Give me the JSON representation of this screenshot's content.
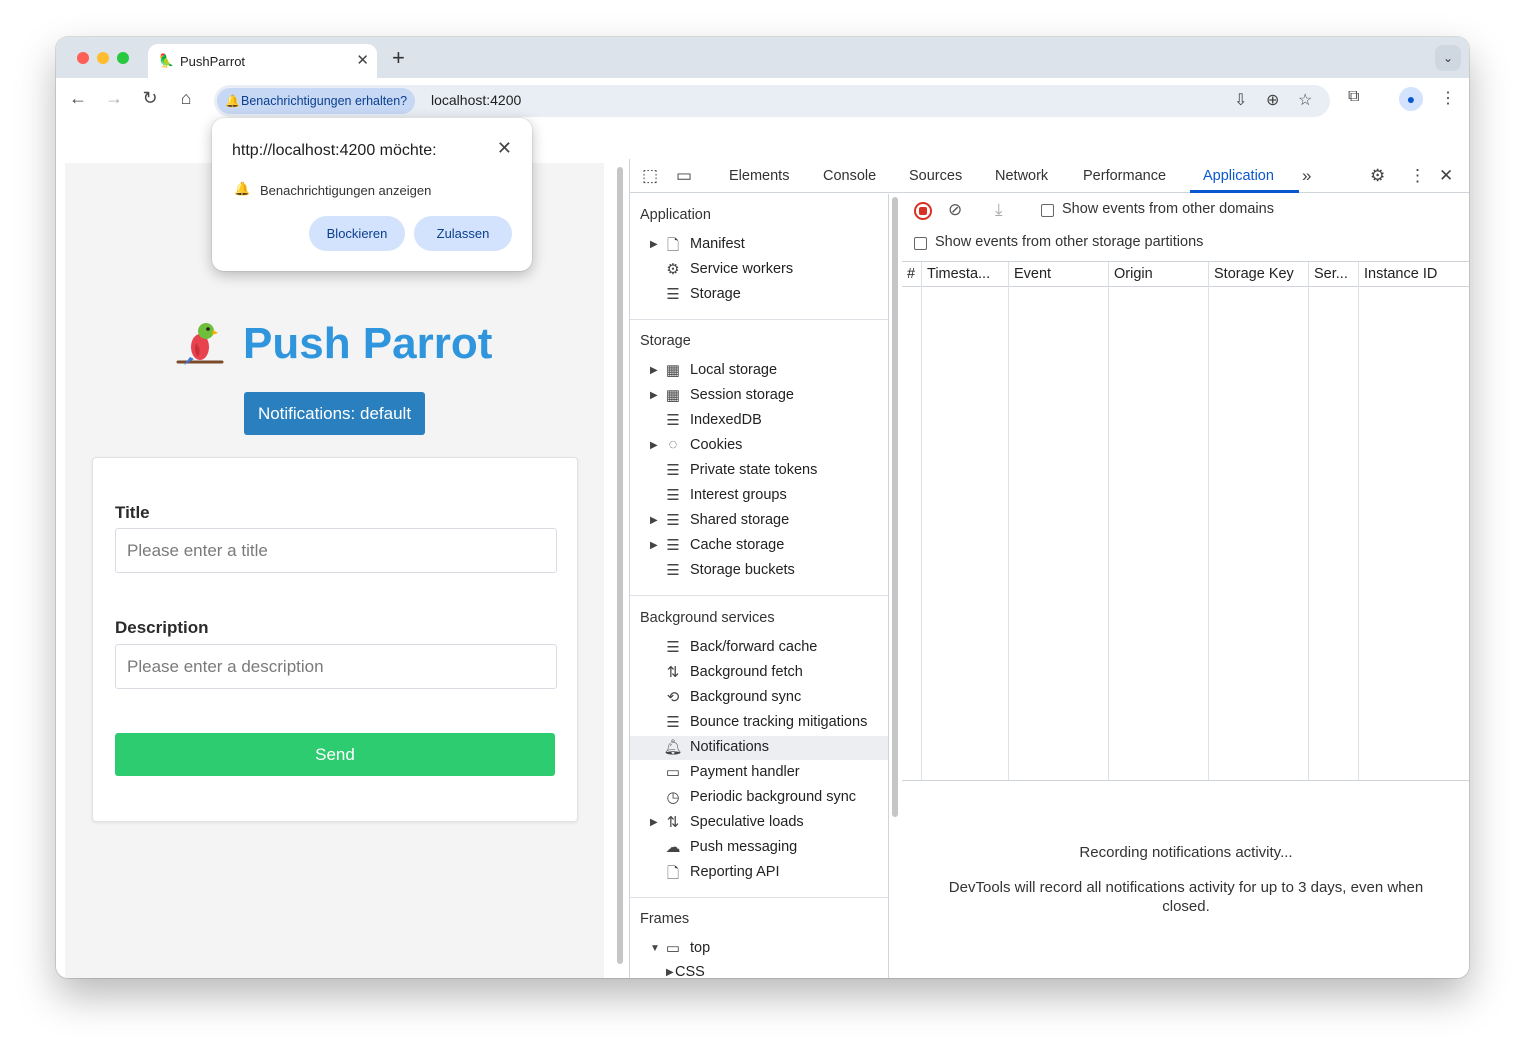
{
  "browser": {
    "tab_title": "PushParrot",
    "tab_favicon": "🦜",
    "tab_close": "✕",
    "new_tab": "+",
    "tab_search": "⌄",
    "permission_chip": "Benachrichtigungen erhalten?",
    "url": "localhost:4200",
    "nav": {
      "back": "←",
      "forward": "→",
      "reload": "↻",
      "home": "⌂"
    },
    "omnibox_icons": {
      "install": "⇩",
      "zoom": "⊕",
      "bookmark": "☆"
    },
    "toolbar_icons": {
      "extensions": "⧉",
      "profile": "●",
      "menu": "⋮"
    }
  },
  "permission_popup": {
    "title": "http://localhost:4200 möchte:",
    "close": "✕",
    "bell": "🔔",
    "text": "Benachrichtigungen anzeigen",
    "block_label": "Blockieren",
    "allow_label": "Zulassen"
  },
  "page": {
    "logo": "🦜",
    "title": "Push Parrot",
    "status_button": "Notifications: default",
    "title_label": "Title",
    "title_placeholder": "Please enter a title",
    "description_label": "Description",
    "description_placeholder": "Please enter a description",
    "send_label": "Send"
  },
  "devtools": {
    "tabs": [
      "Elements",
      "Console",
      "Sources",
      "Network",
      "Performance",
      "Application"
    ],
    "active_tab": "Application",
    "more_tabs": "»",
    "icons": {
      "inspect": "⬚",
      "device": "▭",
      "settings": "⚙",
      "menu": "⋮",
      "close": "✕"
    },
    "sidebar": {
      "application_header": "Application",
      "application_items": [
        "Manifest",
        "Service workers",
        "Storage"
      ],
      "storage_header": "Storage",
      "storage_items": [
        "Local storage",
        "Session storage",
        "IndexedDB",
        "Cookies",
        "Private state tokens",
        "Interest groups",
        "Shared storage",
        "Cache storage",
        "Storage buckets"
      ],
      "background_header": "Background services",
      "background_items": [
        "Back/forward cache",
        "Background fetch",
        "Background sync",
        "Bounce tracking mitigations",
        "Notifications",
        "Payment handler",
        "Periodic background sync",
        "Speculative loads",
        "Push messaging",
        "Reporting API"
      ],
      "selected_item": "Notifications",
      "frames_header": "Frames",
      "frames_items": [
        "top",
        "CSS"
      ]
    },
    "main": {
      "checkbox_other_domains": "Show events from other domains",
      "checkbox_other_partitions": "Show events from other storage partitions",
      "columns": [
        "#",
        "Timesta...",
        "Event",
        "Origin",
        "Storage Key",
        "Ser...",
        "Instance ID"
      ],
      "empty_title": "Recording notifications activity...",
      "empty_text": "DevTools will record all notifications activity for up to 3 days, even when closed."
    }
  },
  "colors": {
    "brand_blue": "#2f95dc",
    "status_button": "#2a7fbf",
    "send_button": "#2ecc71",
    "devtools_accent": "#0b57d0",
    "record_red": "#d93025"
  }
}
